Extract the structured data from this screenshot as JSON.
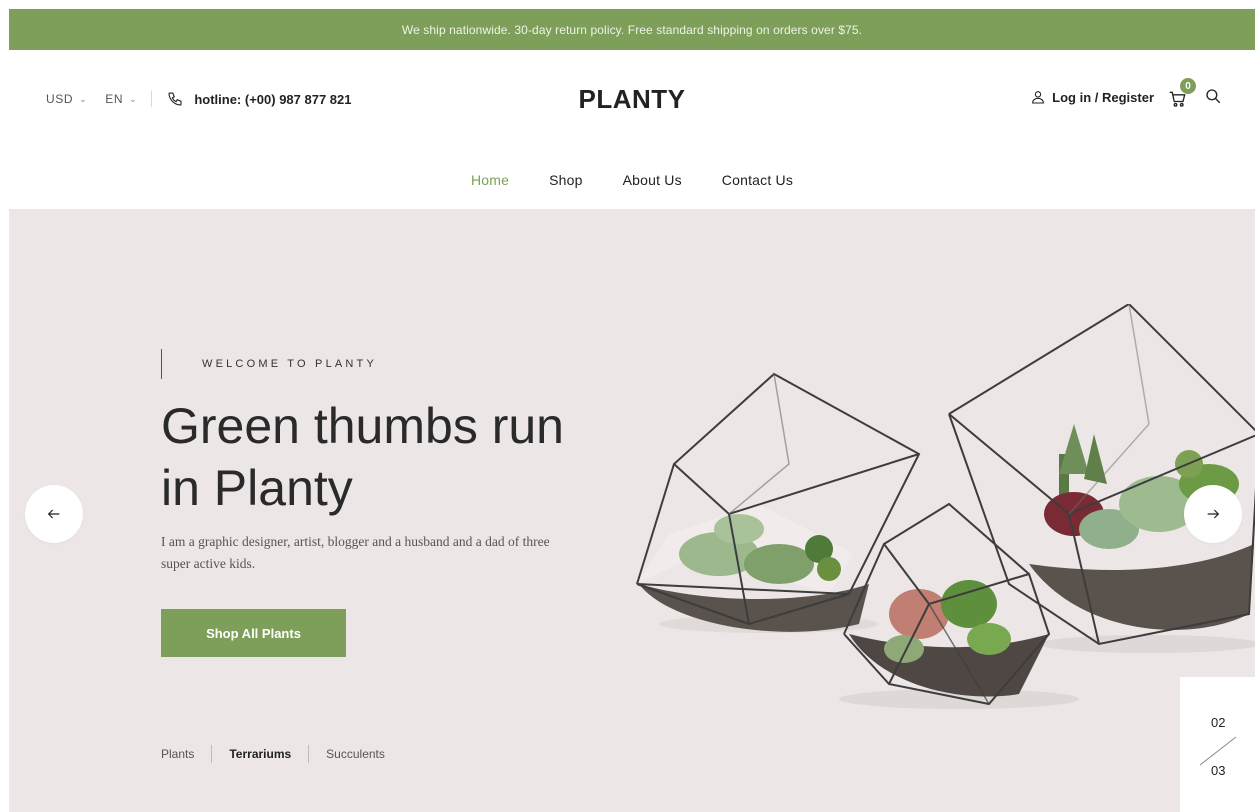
{
  "announcement": "We ship nationwide. 30-day return policy. Free standard shipping on orders over $75.",
  "header": {
    "currency": "USD",
    "language": "EN",
    "hotline": "hotline: (+00) 987 877 821",
    "logo": "PLANTY",
    "login_label": "Log in / Register",
    "cart_count": "0"
  },
  "nav": {
    "items": [
      {
        "label": "Home",
        "active": true
      },
      {
        "label": "Shop",
        "active": false
      },
      {
        "label": "About Us",
        "active": false
      },
      {
        "label": "Contact Us",
        "active": false
      }
    ]
  },
  "hero": {
    "kicker": "WELCOME TO PLANTY",
    "headline_line1": "Green thumbs run",
    "headline_line2": "in Planty",
    "subtext": "I am a graphic designer, artist, blogger and a husband and a dad of three super active kids.",
    "cta_label": "Shop All Plants",
    "categories": [
      {
        "label": "Plants",
        "active": false
      },
      {
        "label": "Terrariums",
        "active": true
      },
      {
        "label": "Succulents",
        "active": false
      }
    ],
    "slide_current": "02",
    "slide_total": "03"
  },
  "colors": {
    "accent": "#7d9f5a",
    "hero_bg": "#ece7e6",
    "text": "#222222"
  },
  "icons": {
    "phone": "phone-icon",
    "user": "user-icon",
    "cart": "cart-icon",
    "search": "search-icon",
    "prev": "arrow-left-icon",
    "next": "arrow-right-icon"
  }
}
